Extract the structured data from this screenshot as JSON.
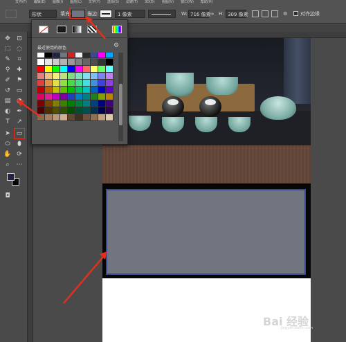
{
  "menu": [
    "文件(F)",
    "编辑(E)",
    "图像(I)",
    "图层(L)",
    "文字(Y)",
    "选择(S)",
    "滤镜(T)",
    "3D(D)",
    "视图(V)",
    "窗口(W)",
    "帮助(H)"
  ],
  "options_bar": {
    "tool_mode": "形状",
    "fill_label": "填充:",
    "stroke_label": "描边:",
    "stroke_width": "1 像素",
    "w_label": "W:",
    "w_value": "716 像素",
    "link_icon": "∞",
    "h_label": "H:",
    "h_value": "309 像素",
    "align_edges_label": "对齐边缘",
    "fill_color": "#71757f"
  },
  "fill_popup": {
    "recent_label": "最近使用的颜色",
    "recent_colors": [
      "#ffffff",
      "#000000",
      "#1d2742",
      "#71757f",
      "#c62828",
      "#f0f0f0",
      "#2b2b2b",
      "#3a4a8e",
      "#ff00ff",
      "#00aaff"
    ],
    "swatches": [
      "#ffffff",
      "#e6e6e6",
      "#cccccc",
      "#b3b3b3",
      "#999999",
      "#808080",
      "#666666",
      "#4d4d4d",
      "#333333",
      "#000000",
      "#ff0000",
      "#ffff00",
      "#00ff00",
      "#00ffff",
      "#0000ff",
      "#ff00ff",
      "#ff6666",
      "#ffff66",
      "#66ff66",
      "#66ffff",
      "#e08080",
      "#f0c080",
      "#f0f080",
      "#c0e080",
      "#80e080",
      "#80e0c0",
      "#80e0f0",
      "#80c0f0",
      "#8080f0",
      "#c080f0",
      "#e04040",
      "#e09040",
      "#e0e040",
      "#90e040",
      "#40e040",
      "#40e090",
      "#40e0e0",
      "#4090e0",
      "#4040e0",
      "#9040e0",
      "#c00000",
      "#c06000",
      "#c0c000",
      "#60c000",
      "#00c000",
      "#00c060",
      "#00c0c0",
      "#0060c0",
      "#0000c0",
      "#6000c0",
      "#e00060",
      "#e02090",
      "#c000c0",
      "#8000a0",
      "#2040c0",
      "#0080c0",
      "#008080",
      "#208020",
      "#80a000",
      "#c08000",
      "#800000",
      "#804000",
      "#808000",
      "#408000",
      "#008000",
      "#008040",
      "#008080",
      "#004080",
      "#000080",
      "#400080",
      "#500000",
      "#503000",
      "#505000",
      "#305000",
      "#005000",
      "#005030",
      "#005050",
      "#003050",
      "#000050",
      "#300050",
      "#8a6a4a",
      "#a08060",
      "#b89878",
      "#d0b090",
      "#604830",
      "#403020",
      "#705040",
      "#907050",
      "#c0a080",
      "#e0c8a8"
    ]
  },
  "colors": {
    "foreground": "#1d2742",
    "background": "#050505",
    "shape_fill": "#71757f",
    "annotation": "#e1301e"
  },
  "watermark": {
    "text": "Bai 经验",
    "sub": "jingyan.baidu.com"
  }
}
